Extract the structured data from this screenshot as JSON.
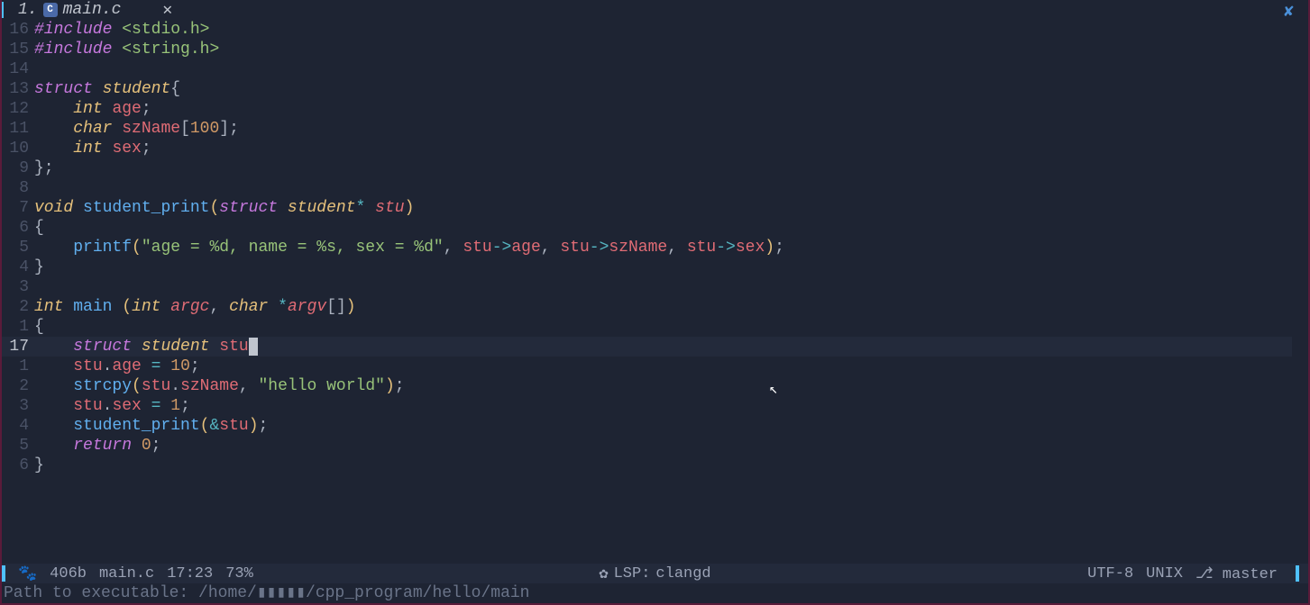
{
  "tab": {
    "index": "1.",
    "filename": "main.c",
    "close_glyph": "✕",
    "window_close_glyph": "✘"
  },
  "code": {
    "lines": [
      {
        "n": "16",
        "html": "<span class='pp'>#include</span> <span class='inc'>&lt;stdio.h&gt;</span>"
      },
      {
        "n": "15",
        "html": "<span class='pp'>#include</span> <span class='inc'>&lt;string.h&gt;</span>"
      },
      {
        "n": "14",
        "html": ""
      },
      {
        "n": "13",
        "html": "<span class='kw'>struct</span> <span class='ty'>student</span><span class='pn'>{</span>"
      },
      {
        "n": "12",
        "html": "    <span class='ty'>int</span> <span class='id'>age</span><span class='pn'>;</span>"
      },
      {
        "n": "11",
        "html": "    <span class='ty'>char</span> <span class='id'>szName</span><span class='pn'>[</span><span class='num'>100</span><span class='pn'>];</span>"
      },
      {
        "n": "10",
        "html": "    <span class='ty'>int</span> <span class='id'>sex</span><span class='pn'>;</span>"
      },
      {
        "n": "9",
        "html": "<span class='pn'>};</span>"
      },
      {
        "n": "8",
        "html": ""
      },
      {
        "n": "7",
        "html": "<span class='ty'>void</span> <span class='fn'>student_print</span><span class='pn2'>(</span><span class='kw'>struct</span> <span class='ty'>student</span><span class='op'>*</span> <span class='param'>stu</span><span class='pn2'>)</span>"
      },
      {
        "n": "6",
        "html": "<span class='pn'>{</span>"
      },
      {
        "n": "5",
        "html": "    <span class='fn'>printf</span><span class='pn2'>(</span><span class='str'>\"age = %d, name = %s, sex = %d\"</span><span class='pn'>,</span> <span class='var'>stu</span><span class='op'>-&gt;</span><span class='id'>age</span><span class='pn'>,</span> <span class='var'>stu</span><span class='op'>-&gt;</span><span class='id'>szName</span><span class='pn'>,</span> <span class='var'>stu</span><span class='op'>-&gt;</span><span class='id'>sex</span><span class='pn2'>)</span><span class='pn'>;</span>"
      },
      {
        "n": "4",
        "html": "<span class='pn'>}</span>"
      },
      {
        "n": "3",
        "html": ""
      },
      {
        "n": "2",
        "html": "<span class='ty'>int</span> <span class='fn'>main</span> <span class='pn2'>(</span><span class='ty'>int</span> <span class='param'>argc</span><span class='pn'>,</span> <span class='ty'>char</span> <span class='op'>*</span><span class='param'>argv</span><span class='pn'>[]</span><span class='pn2'>)</span>"
      },
      {
        "n": "1",
        "html": "<span class='pn'>{</span>"
      },
      {
        "n": "17",
        "current": true,
        "html": "    <span class='kw'>struct</span> <span class='ty'>student</span> <span class='id'>stu</span><span class='cursor'></span>"
      },
      {
        "n": "1",
        "html": "    <span class='var'>stu</span><span class='pn'>.</span><span class='id'>age</span> <span class='op'>=</span> <span class='num'>10</span><span class='pn'>;</span>"
      },
      {
        "n": "2",
        "html": "    <span class='fn'>strcpy</span><span class='pn2'>(</span><span class='var'>stu</span><span class='pn'>.</span><span class='id'>szName</span><span class='pn'>,</span> <span class='str'>\"hello world\"</span><span class='pn2'>)</span><span class='pn'>;</span>"
      },
      {
        "n": "3",
        "html": "    <span class='var'>stu</span><span class='pn'>.</span><span class='id'>sex</span> <span class='op'>=</span> <span class='num'>1</span><span class='pn'>;</span>"
      },
      {
        "n": "4",
        "html": "    <span class='fn'>student_print</span><span class='pn2'>(</span><span class='op'>&amp;</span><span class='var'>stu</span><span class='pn2'>)</span><span class='pn'>;</span>"
      },
      {
        "n": "5",
        "html": "    <span class='kw'>return</span> <span class='num'>0</span><span class='pn'>;</span>"
      },
      {
        "n": "6",
        "html": "<span class='pn'>}</span>"
      }
    ]
  },
  "status": {
    "file_size": "406b",
    "filename": "main.c",
    "position": "17:23",
    "percent": "73%",
    "lsp_label": "LSP:",
    "lsp_server": "clangd",
    "encoding": "UTF-8",
    "os": "UNIX",
    "branch": "master"
  },
  "cmdline": "Path to executable: /home/▮▮▮▮▮/cpp_program/hello/main"
}
